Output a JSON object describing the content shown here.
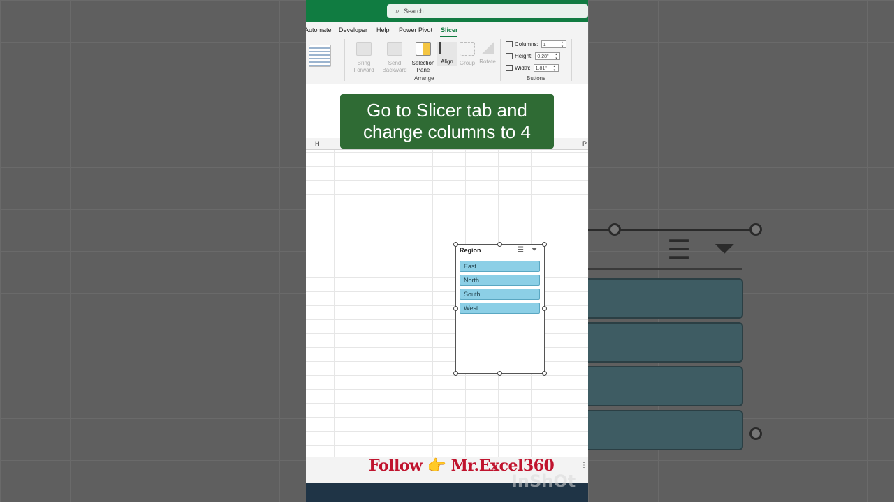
{
  "search": {
    "label": "Search"
  },
  "tabs": [
    {
      "label": "Automate"
    },
    {
      "label": "Developer"
    },
    {
      "label": "Help"
    },
    {
      "label": "Power Pivot"
    },
    {
      "label": "Slicer",
      "active": true
    }
  ],
  "ribbon": {
    "bring_forward": "Bring Forward",
    "send_backward": "Send Backward",
    "selection_pane": "Selection Pane",
    "align": "Align",
    "group": "Group",
    "rotate": "Rotate",
    "arrange_label": "Arrange",
    "buttons_label": "Buttons",
    "columns_label": "Columns:",
    "columns_value": "1",
    "height_label": "Height:",
    "height_value": "0.28\"",
    "width_label": "Width:",
    "width_value": "1.81\""
  },
  "columns": {
    "left": "H",
    "right": "P"
  },
  "overlay": {
    "line1": "Go to Slicer tab and",
    "line2": "change columns to 4"
  },
  "slicer": {
    "title": "Region",
    "items": [
      "East",
      "North",
      "South",
      "West"
    ]
  },
  "footer": {
    "follow_text": "Follow 👉 Mr.Excel360",
    "watermark": "InShOt"
  },
  "colors": {
    "excel_green": "#107c41",
    "slicer_item": "#8ccfe6",
    "overlay_bg": "#2f6b34",
    "follow_red": "#c0142e"
  }
}
